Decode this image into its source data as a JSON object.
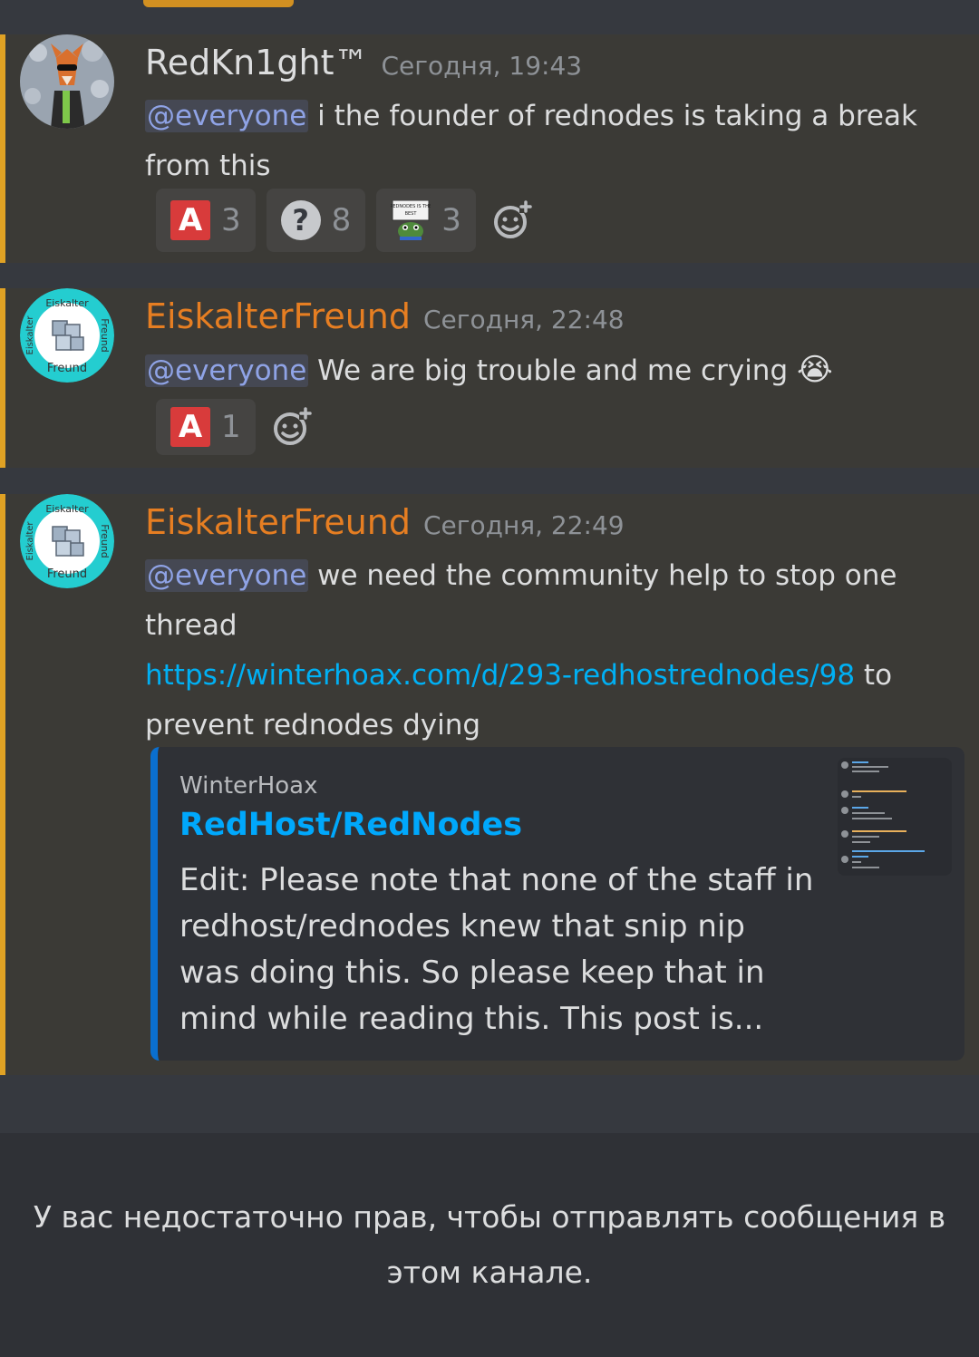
{
  "messages": [
    {
      "username": "RedKn1ght™",
      "username_color": "#dcddde",
      "timestamp": "Сегодня, 19:43",
      "mention": "@everyone",
      "text_line1": " i the founder of rednodes is taking a break",
      "text_line2": "from this",
      "reactions": [
        {
          "emoji": "A-emoji",
          "count": "3"
        },
        {
          "emoji": "question-emoji",
          "count": "8"
        },
        {
          "emoji": "pepe-sign-emoji",
          "count": "3",
          "sign_text": "REDNODES IS THE BEST"
        }
      ]
    },
    {
      "username": "EiskalterFreund",
      "username_color": "#e67e22",
      "timestamp": "Сегодня, 22:48",
      "mention": "@everyone",
      "text": " We are big trouble and me crying",
      "emoji": "😭",
      "reactions": [
        {
          "emoji": "A-emoji",
          "count": "1"
        }
      ]
    },
    {
      "username": "EiskalterFreund",
      "username_color": "#e67e22",
      "timestamp": "Сегодня, 22:49",
      "mention": "@everyone",
      "text_line1": " we need the community help to stop one",
      "text_line2": "thread",
      "link": "https://winterhoax.com/d/293-redhostrednodes/98",
      "text_after_link": " to",
      "text_line4": "prevent rednodes dying",
      "embed": {
        "provider": "WinterHoax",
        "title": "RedHost/RedNodes",
        "description": "Edit: Please note that none of the staff in redhost/rednodes knew that snip nip was doing this. So please keep that in mind while reading this. This post is..."
      }
    }
  ],
  "avatar_text": {
    "top": "Eiskalter",
    "left": "Eiskalter",
    "right": "Freund",
    "bottom": "Freund"
  },
  "footer": {
    "no_permission_text": "У вас недостаточно прав, чтобы отправлять сообщения в этом канале."
  },
  "colors": {
    "background": "#36393f",
    "message_highlight": "#3b3a36",
    "highlight_bar": "#e0a224",
    "mention": "#8fa3e6",
    "link": "#00b0f4"
  }
}
